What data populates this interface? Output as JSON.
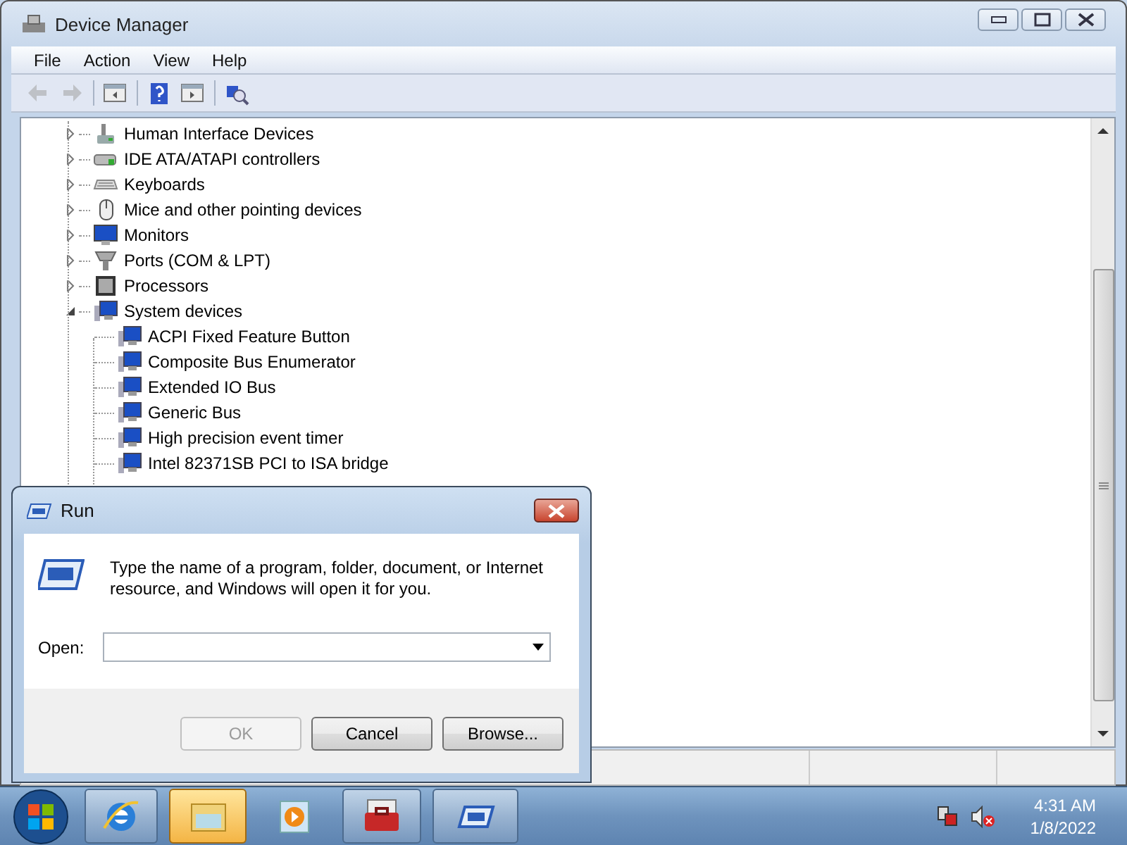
{
  "window": {
    "title": "Device Manager"
  },
  "menu": [
    {
      "label": "File"
    },
    {
      "label": "Action"
    },
    {
      "label": "View"
    },
    {
      "label": "Help"
    }
  ],
  "toolbar": [
    {
      "disabled": true
    },
    {
      "disabled": true
    },
    {
      "disabled": false
    },
    {
      "disabled": false
    },
    {
      "disabled": false
    },
    {
      "disabled": false
    }
  ],
  "tree": [
    {
      "label": "Human Interface Devices",
      "expanded": false
    },
    {
      "label": "IDE ATA/ATAPI controllers",
      "expanded": false
    },
    {
      "label": "Keyboards",
      "expanded": false
    },
    {
      "label": "Mice and other pointing devices",
      "expanded": false
    },
    {
      "label": "Monitors",
      "expanded": false
    },
    {
      "label": "Ports (COM & LPT)",
      "expanded": false
    },
    {
      "label": "Processors",
      "expanded": false
    },
    {
      "label": "System devices",
      "expanded": true,
      "children": [
        {
          "label": "ACPI Fixed Feature Button"
        },
        {
          "label": "Composite Bus Enumerator"
        },
        {
          "label": "Extended IO Bus"
        },
        {
          "label": "Generic Bus"
        },
        {
          "label": "High precision event timer"
        },
        {
          "label": "Intel 82371SB PCI to ISA bridge"
        }
      ]
    }
  ],
  "run_dialog": {
    "title": "Run",
    "message": "Type the name of a program, folder, document, or Internet resource, and Windows will open it for you.",
    "open_label": "Open:",
    "buttons": [
      {
        "label": "OK",
        "disabled": true
      },
      {
        "label": "Cancel",
        "disabled": false
      },
      {
        "label": "Browse...",
        "disabled": false
      }
    ]
  },
  "taskbar": {
    "items": [
      {
        "running": true,
        "selected": false
      },
      {
        "running": true,
        "selected": true
      },
      {
        "running": false,
        "selected": false
      },
      {
        "running": true,
        "selected": false
      },
      {
        "running": true,
        "selected": false
      }
    ],
    "time": "4:31 AM",
    "date": "1/8/2022"
  }
}
